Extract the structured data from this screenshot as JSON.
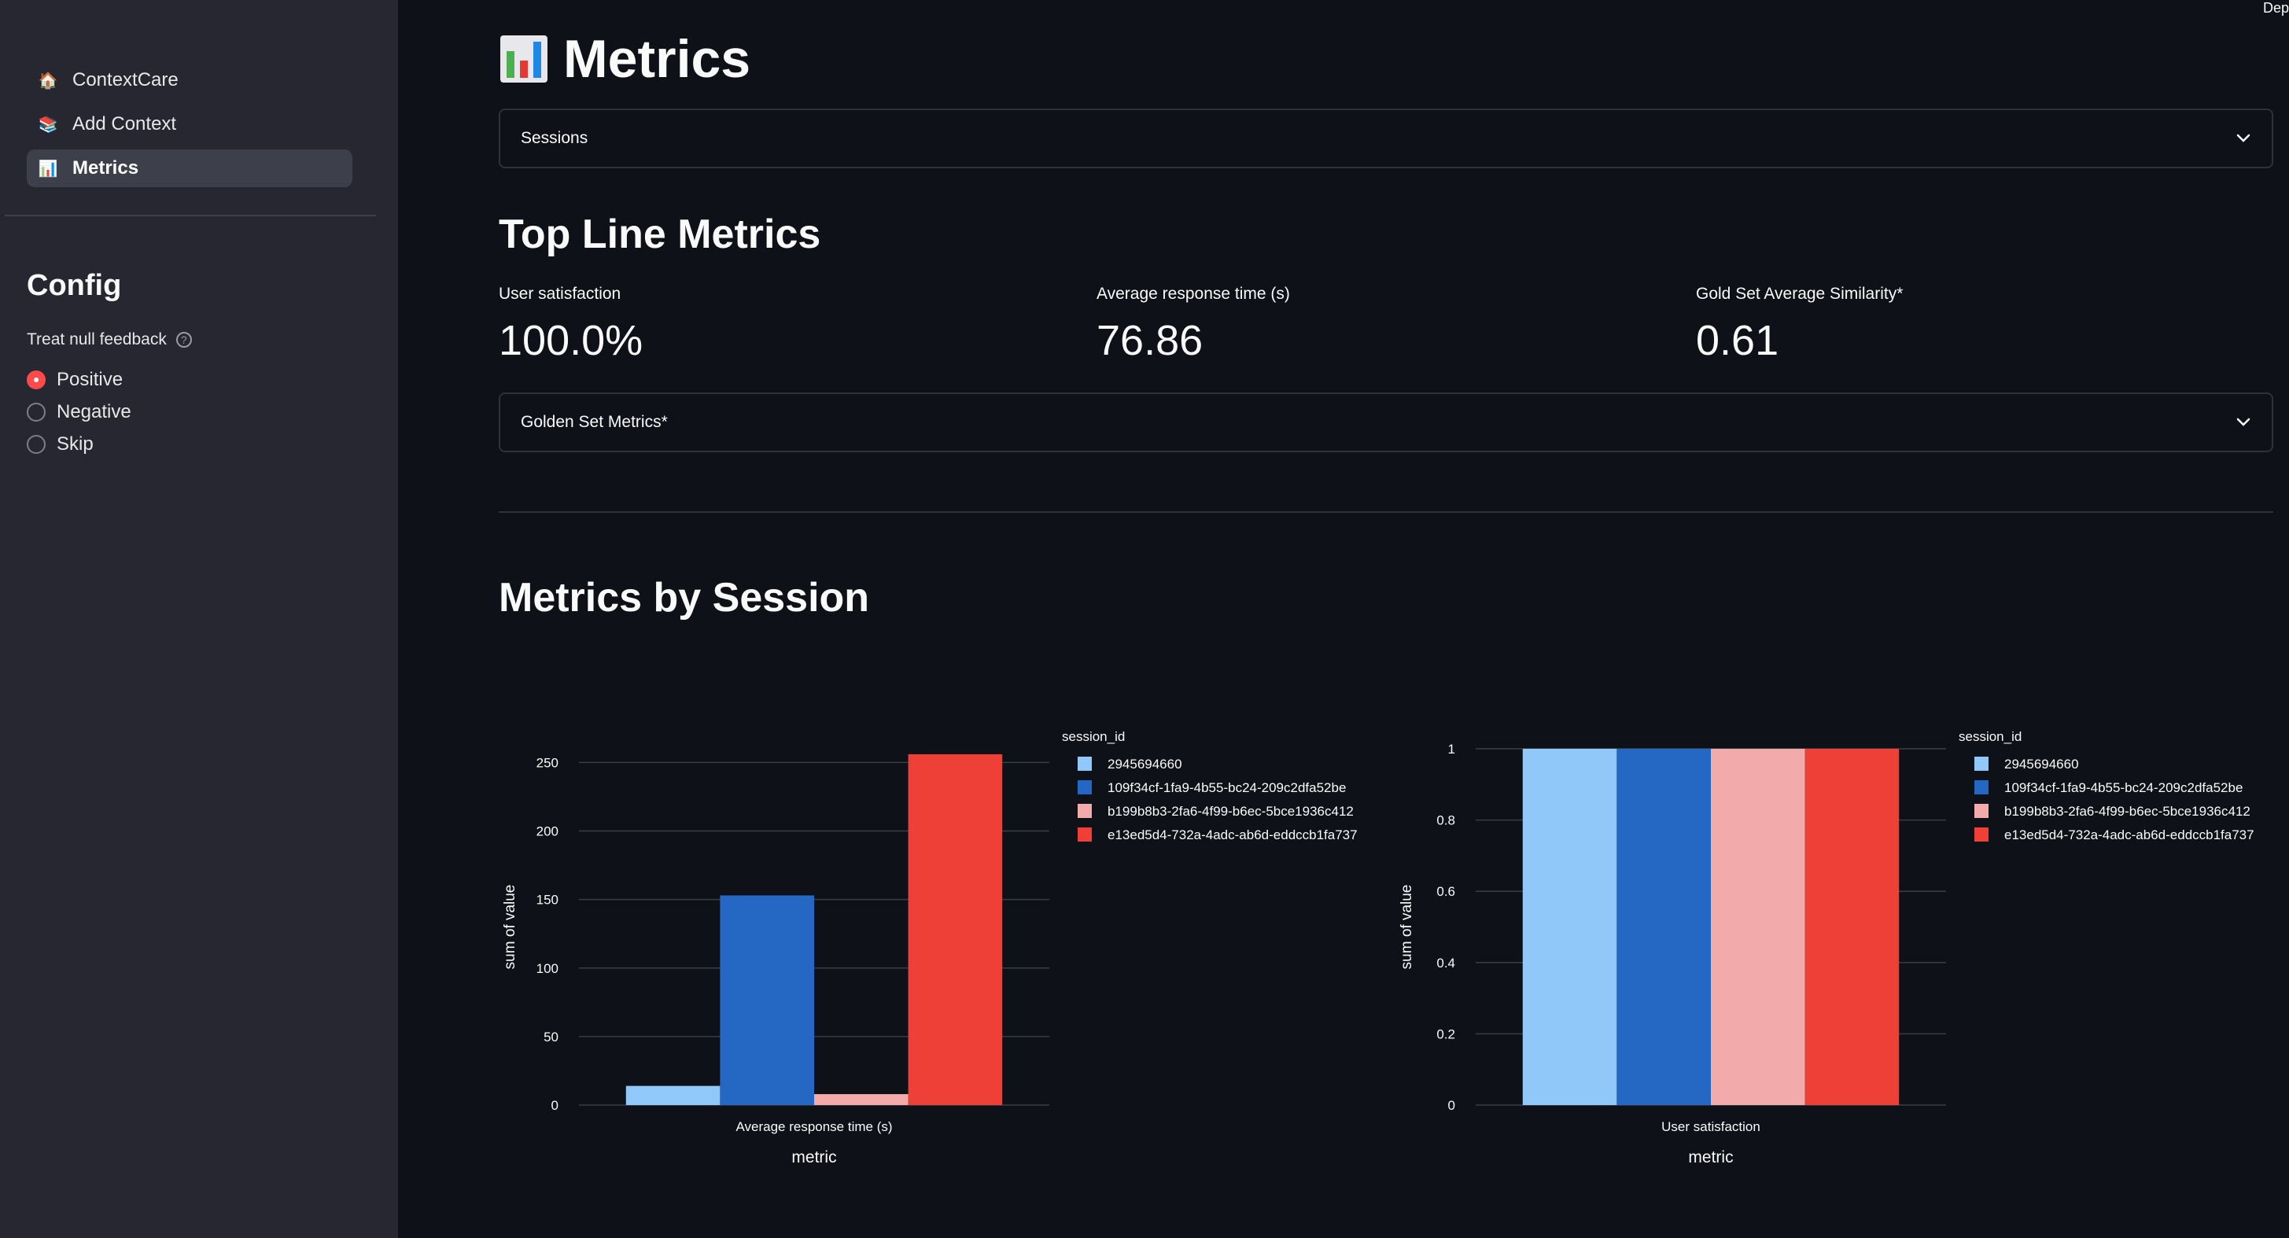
{
  "sidebar": {
    "nav": [
      {
        "label": "ContextCare",
        "icon": "house-icon",
        "active": false
      },
      {
        "label": "Add Context",
        "icon": "books-icon",
        "active": false
      },
      {
        "label": "Metrics",
        "icon": "bar-chart-icon",
        "active": true
      }
    ],
    "config_title": "Config",
    "null_feedback_label": "Treat null feedback",
    "radio_options": [
      {
        "label": "Positive",
        "selected": true
      },
      {
        "label": "Negative",
        "selected": false
      },
      {
        "label": "Skip",
        "selected": false
      }
    ]
  },
  "header": {
    "deploy_label": "Dep"
  },
  "main": {
    "title": "Metrics",
    "sessions_expander": "Sessions",
    "top_line_title": "Top Line Metrics",
    "metrics": [
      {
        "label": "User satisfaction",
        "value": "100.0%"
      },
      {
        "label": "Average response time (s)",
        "value": "76.86"
      },
      {
        "label": "Gold Set Average Similarity*",
        "value": "0.61"
      }
    ],
    "golden_expander": "Golden Set Metrics*",
    "by_session_title": "Metrics by Session"
  },
  "colors": {
    "accent": "#ff4b4b",
    "series": [
      "#90c8fa",
      "#2568c4",
      "#f3aaab",
      "#ee4037"
    ]
  },
  "chart_data": [
    {
      "type": "bar",
      "categories": [
        "Average response time (s)"
      ],
      "xlabel": "metric",
      "ylabel": "sum of value",
      "ylim": [
        0,
        260
      ],
      "yticks": [
        0,
        50,
        100,
        150,
        200,
        250
      ],
      "legend_title": "session_id",
      "legend_position": "top-right",
      "grid": true,
      "series": [
        {
          "name": "2945694660",
          "values": [
            14
          ]
        },
        {
          "name": "109f34cf-1fa9-4b55-bc24-209c2dfa52be",
          "values": [
            153
          ]
        },
        {
          "name": "b199b8b3-2fa6-4f99-b6ec-5bce1936c412",
          "values": [
            8
          ]
        },
        {
          "name": "e13ed5d4-732a-4adc-ab6d-eddccb1fa737",
          "values": [
            256
          ]
        }
      ]
    },
    {
      "type": "bar",
      "categories": [
        "User satisfaction"
      ],
      "xlabel": "metric",
      "ylabel": "sum of value",
      "ylim": [
        0,
        1
      ],
      "yticks": [
        0,
        0.2,
        0.4,
        0.6,
        0.8,
        1
      ],
      "legend_title": "session_id",
      "legend_position": "top-right",
      "grid": true,
      "series": [
        {
          "name": "2945694660",
          "values": [
            1
          ]
        },
        {
          "name": "109f34cf-1fa9-4b55-bc24-209c2dfa52be",
          "values": [
            1
          ]
        },
        {
          "name": "b199b8b3-2fa6-4f99-b6ec-5bce1936c412",
          "values": [
            1
          ]
        },
        {
          "name": "e13ed5d4-732a-4adc-ab6d-eddccb1fa737",
          "values": [
            1
          ]
        }
      ]
    }
  ]
}
